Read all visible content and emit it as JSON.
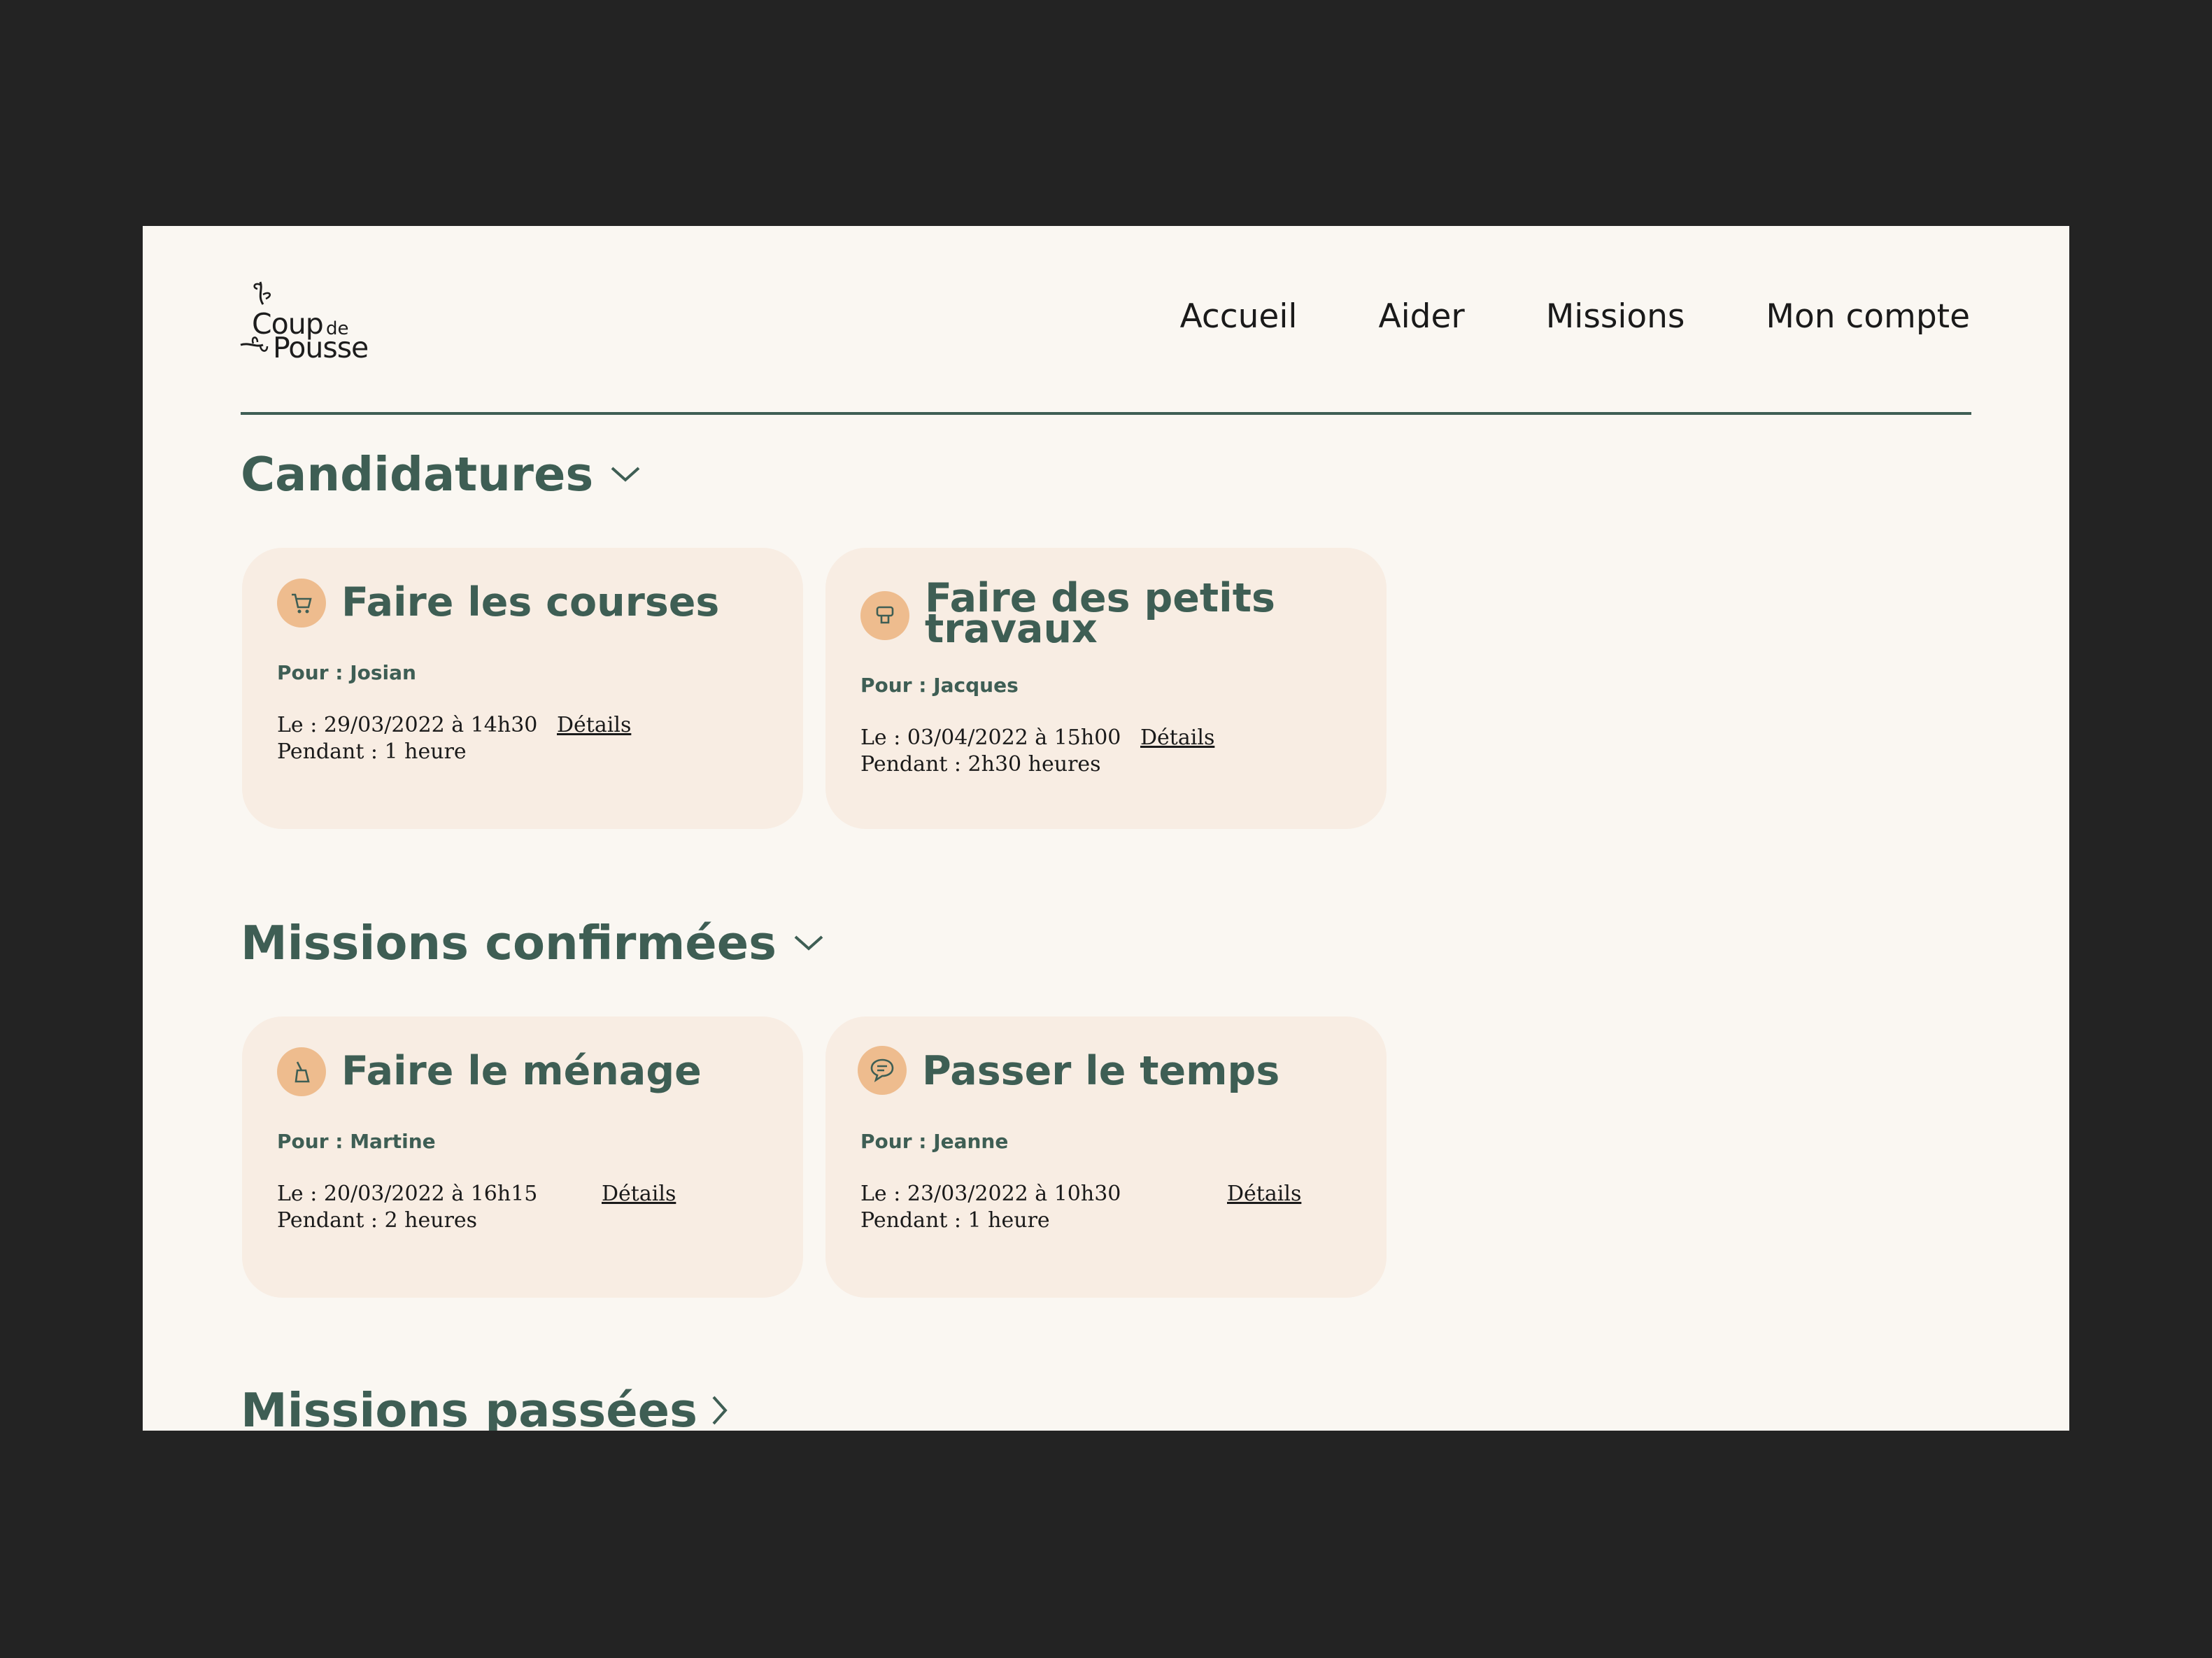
{
  "logo": {
    "line1": "Coup",
    "de": "de",
    "line2": "Pousse"
  },
  "nav": [
    "Accueil",
    "Aider",
    "Missions",
    "Mon compte"
  ],
  "sections": {
    "candidatures": {
      "title": "Candidatures",
      "cards": [
        {
          "icon": "shopping-cart-icon",
          "title": "Faire les courses",
          "for": "Pour : Josian",
          "date": "Le : 29/03/2022 à 14h30",
          "duration": "Pendant : 1 heure",
          "details": "Détails"
        },
        {
          "icon": "paint-roller-icon",
          "title": "Faire des petits travaux",
          "for": "Pour : Jacques",
          "date": "Le : 03/04/2022 à 15h00",
          "duration": "Pendant : 2h30 heures",
          "details": "Détails"
        }
      ]
    },
    "confirmees": {
      "title": "Missions confirmées",
      "cards": [
        {
          "icon": "broom-icon",
          "title": "Faire le ménage",
          "for": "Pour : Martine",
          "date": "Le : 20/03/2022 à 16h15",
          "duration": "Pendant : 2 heures",
          "details": "Détails"
        },
        {
          "icon": "chat-bubbles-icon",
          "title": "Passer le temps",
          "for": "Pour : Jeanne",
          "date": "Le : 23/03/2022 à 10h30",
          "duration": "Pendant : 1 heure",
          "details": "Détails"
        }
      ]
    },
    "passees": {
      "title": "Missions passées"
    }
  },
  "colors": {
    "accent": "#3e5e54",
    "card": "#f8ede3",
    "icon_bg": "#eebc8e",
    "page": "#faf7f2",
    "backdrop": "#232323"
  }
}
